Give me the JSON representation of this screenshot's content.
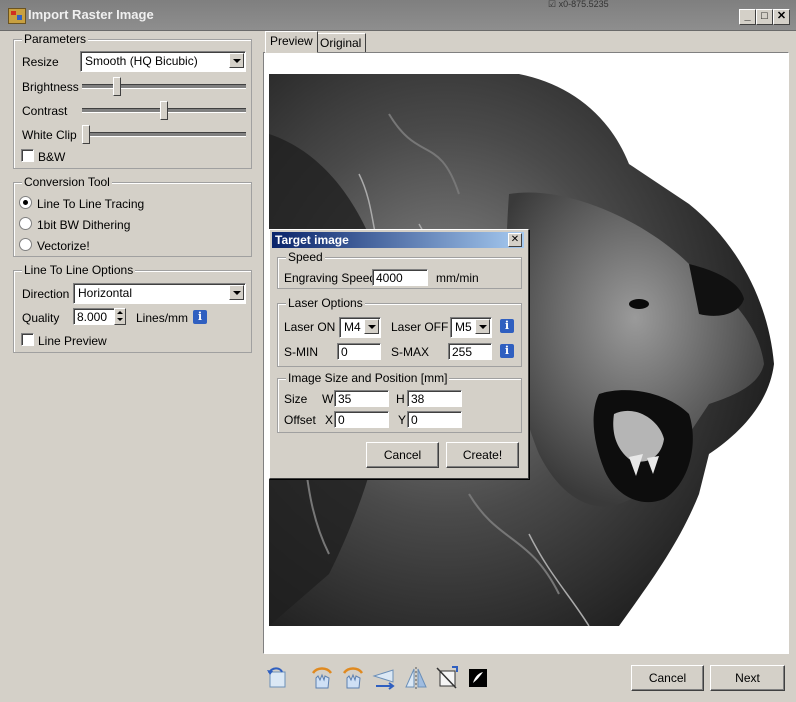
{
  "window": {
    "title": "Import Raster Image",
    "status_fragment": "☑ x0-875.5235"
  },
  "parameters": {
    "legend": "Parameters",
    "resize_label": "Resize",
    "resize_value": "Smooth (HQ Bicubic)",
    "brightness_label": "Brightness",
    "brightness_level": 0.2,
    "contrast_label": "Contrast",
    "contrast_level": 0.5,
    "white_clip_label": "White Clip",
    "white_clip_level": 0.0,
    "bw_label": "B&W",
    "bw_checked": false
  },
  "conversion": {
    "legend": "Conversion Tool",
    "options": [
      "Line To Line Tracing",
      "1bit BW Dithering",
      "Vectorize!"
    ],
    "selected": 0
  },
  "line_options": {
    "legend": "Line To Line Options",
    "direction_label": "Direction",
    "direction_value": "Horizontal",
    "quality_label": "Quality",
    "quality_value": "8.000",
    "quality_unit": "Lines/mm",
    "line_preview_label": "Line Preview",
    "line_preview_checked": false
  },
  "tabs": [
    "Preview",
    "Original"
  ],
  "active_tab": 0,
  "target_dialog": {
    "title": "Target image",
    "speed": {
      "legend": "Speed",
      "label": "Engraving Speed",
      "value": "4000",
      "unit": "mm/min"
    },
    "laser": {
      "legend": "Laser Options",
      "on_label": "Laser ON",
      "on_value": "M4",
      "off_label": "Laser OFF",
      "off_value": "M5",
      "smin_label": "S-MIN",
      "smin_value": "0",
      "smax_label": "S-MAX",
      "smax_value": "255"
    },
    "size": {
      "legend": "Image Size and Position [mm]",
      "size_label": "Size",
      "w_label": "W",
      "w_value": "35",
      "h_label": "H",
      "h_value": "38",
      "offset_label": "Offset",
      "x_label": "X",
      "x_value": "0",
      "y_label": "Y",
      "y_value": "0"
    },
    "cancel_label": "Cancel",
    "create_label": "Create!"
  },
  "footer": {
    "cancel_label": "Cancel",
    "next_label": "Next"
  },
  "icons": {
    "info": "info-icon",
    "tools": [
      "rotate-ccw-icon",
      "rotate-hand-left-icon",
      "rotate-hand-right-icon",
      "flip-horizontal-icon",
      "flip-vertical-icon",
      "crop-icon",
      "invert-icon"
    ]
  },
  "colors": {
    "window_bg": "#d4d0c8",
    "dialog_title_start": "#0a246a",
    "dialog_title_end": "#a6caf0",
    "info_blue": "#2f5fc0"
  }
}
